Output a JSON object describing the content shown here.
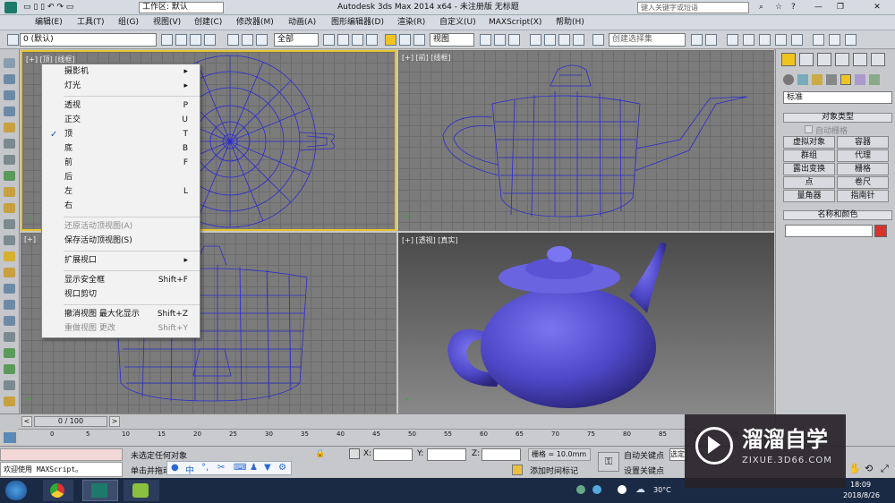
{
  "titlebar": {
    "workspace": "工作区: 默认",
    "title": "Autodesk 3ds Max  2014 x64    - 未注册版   无标题",
    "search_placeholder": "键入关键字或短语"
  },
  "menu": [
    "编辑(E)",
    "工具(T)",
    "组(G)",
    "视图(V)",
    "创建(C)",
    "修改器(M)",
    "动画(A)",
    "图形编辑器(D)",
    "渲染(R)",
    "自定义(U)",
    "MAXScript(X)",
    "帮助(H)"
  ],
  "toolbar": {
    "layer": "0 (默认)",
    "filter": "全部",
    "view": "视图",
    "selection_set": "创建选择集"
  },
  "viewports": {
    "top_left": "[+] [顶] [线框]",
    "top_right": "[+] [前] [线框]",
    "bottom_left": "[+]",
    "bottom_right": "[+] [透视] [真实]"
  },
  "context_menu": {
    "items": [
      {
        "label": "摄影机",
        "key": "",
        "arrow": "▸",
        "checked": false,
        "disabled": false
      },
      {
        "label": "灯光",
        "key": "",
        "arrow": "▸",
        "checked": false,
        "disabled": false
      },
      {
        "label": "透视",
        "key": "P",
        "arrow": "",
        "checked": false,
        "disabled": false
      },
      {
        "label": "正交",
        "key": "U",
        "arrow": "",
        "checked": false,
        "disabled": false
      },
      {
        "label": "顶",
        "key": "T",
        "arrow": "",
        "checked": true,
        "disabled": false
      },
      {
        "label": "底",
        "key": "B",
        "arrow": "",
        "checked": false,
        "disabled": false
      },
      {
        "label": "前",
        "key": "F",
        "arrow": "",
        "checked": false,
        "disabled": false
      },
      {
        "label": "后",
        "key": "",
        "arrow": "",
        "checked": false,
        "disabled": false
      },
      {
        "label": "左",
        "key": "L",
        "arrow": "",
        "checked": false,
        "disabled": false
      },
      {
        "label": "右",
        "key": "",
        "arrow": "",
        "checked": false,
        "disabled": false
      },
      {
        "label": "还原活动顶视图(A)",
        "key": "",
        "arrow": "",
        "checked": false,
        "disabled": true
      },
      {
        "label": "保存活动顶视图(S)",
        "key": "",
        "arrow": "",
        "checked": false,
        "disabled": false
      },
      {
        "label": "扩展视口",
        "key": "",
        "arrow": "▸",
        "checked": false,
        "disabled": false
      },
      {
        "label": "显示安全框",
        "key": "Shift+F",
        "arrow": "",
        "checked": false,
        "disabled": false
      },
      {
        "label": "视口剪切",
        "key": "",
        "arrow": "",
        "checked": false,
        "disabled": false
      },
      {
        "label": "撤消视图 最大化显示",
        "key": "Shift+Z",
        "arrow": "",
        "checked": false,
        "disabled": false
      },
      {
        "label": "重做视图 更改",
        "key": "Shift+Y",
        "arrow": "",
        "checked": false,
        "disabled": true
      }
    ]
  },
  "right_panel": {
    "dropdown": "标准",
    "object_type_header": "对象类型",
    "autogrid": "自动栅格",
    "buttons": [
      "虚拟对象",
      "容器",
      "群组",
      "代理",
      "露出变换",
      "栅格",
      "点",
      "卷尺",
      "量角器",
      "指南针"
    ],
    "name_color_header": "名称和颜色"
  },
  "timeline": {
    "frame": "0 / 100",
    "ticks": [
      "0",
      "5",
      "10",
      "15",
      "20",
      "25",
      "30",
      "35",
      "40",
      "45",
      "50",
      "55",
      "60",
      "65",
      "70",
      "75",
      "80",
      "85",
      "90",
      "95",
      "100"
    ]
  },
  "status": {
    "script_line": "欢迎使用 MAXScript。",
    "msg1": "未选定任何对象",
    "msg2": "单击并拖动",
    "x_label": "X:",
    "y_label": "Y:",
    "z_label": "Z:",
    "grid": "栅格 = 10.0mm",
    "auto_key": "自动关键点",
    "set_key": "设置关键点",
    "selected": "选定",
    "add_time_tag": "添加时间标记"
  },
  "taskbar": {
    "temp": "30°C",
    "time": "18:09",
    "date": "2018/8/26"
  },
  "watermark": {
    "brand": "溜溜自学",
    "url": "ZIXUE.3D66.COM"
  },
  "colors": {
    "accent": "#f0c420",
    "wire": "#2a2ad0",
    "teapot": "#5550d8"
  }
}
